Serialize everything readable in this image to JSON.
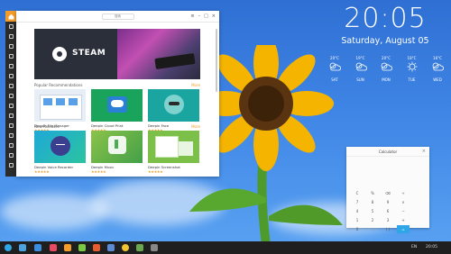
{
  "desktop": {
    "clock": "20:05",
    "date": "Saturday, August 05",
    "weather": [
      {
        "day": "SAT",
        "temp": "20°C",
        "icon": "cloud-sun-icon"
      },
      {
        "day": "SUN",
        "temp": "19°C",
        "icon": "cloud-sun-icon"
      },
      {
        "day": "MON",
        "temp": "20°C",
        "icon": "cloud-sun-icon"
      },
      {
        "day": "TUE",
        "temp": "18°C",
        "icon": "sun-icon"
      },
      {
        "day": "WED",
        "temp": "16°C",
        "icon": "cloud-sun-icon"
      }
    ]
  },
  "software_center": {
    "search_placeholder": "搜索",
    "banner_title": "STEAM",
    "sections": [
      {
        "title": "Popular Recommendations",
        "more": "More",
        "apps": [
          {
            "name": "Deepin File Manager",
            "stars": "★★★★★"
          },
          {
            "name": "Deepin Cloud Print",
            "stars": "★★★★★"
          },
          {
            "name": "Deepin Face",
            "stars": "★★★★★"
          }
        ]
      },
      {
        "title": "New Releases",
        "more": "More",
        "apps": [
          {
            "name": "Deepin Voice Recorder",
            "stars": "★★★★★"
          },
          {
            "name": "Deepin Music",
            "stars": "★★★★★"
          },
          {
            "name": "Deepin Screenshot",
            "stars": "★★★★★"
          }
        ]
      }
    ]
  },
  "calculator": {
    "title": "Calculator",
    "keys": [
      "C",
      "%",
      "⌫",
      "÷",
      "",
      "7",
      "8",
      "9",
      "×",
      "",
      "4",
      "5",
      "6",
      "−",
      "",
      "1",
      "2",
      "3",
      "+",
      "",
      "0",
      ".",
      "( )",
      "=",
      ""
    ]
  },
  "taskbar": {
    "tray": [
      "EN",
      "20:05"
    ]
  },
  "colors": {
    "accent": "#f39c2a",
    "calc_accent": "#2ea6e8"
  }
}
